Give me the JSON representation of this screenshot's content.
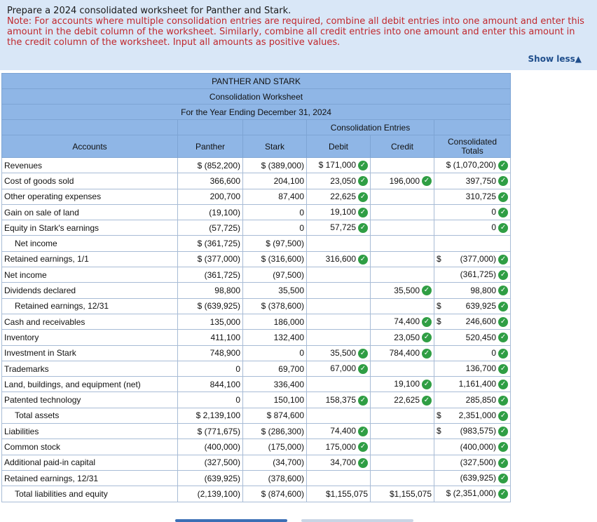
{
  "prompt": {
    "title": "Prepare a 2024 consolidated worksheet for Panther and Stark.",
    "note": "Note: For accounts where multiple consolidation entries are required, combine all debit entries into one amount and enter this amount in the debit column of the worksheet. Similarly, combine all credit entries into one amount and enter this amount in the credit column of the worksheet. Input all amounts as positive values.",
    "show_less": "Show less▲"
  },
  "worksheet": {
    "title1": "PANTHER AND STARK",
    "title2": "Consolidation Worksheet",
    "title3": "For the Year Ending December 31, 2024",
    "entries_header": "Consolidation Entries",
    "col_accounts": "Accounts",
    "col_panther": "Panther",
    "col_stark": "Stark",
    "col_debit": "Debit",
    "col_credit": "Credit",
    "col_totals": "Consolidated Totals",
    "rows": [
      {
        "a": "Revenues",
        "p": "$ (852,200)",
        "s": "$ (389,000)",
        "d": "$  171,000",
        "c": "",
        "t": "$  (1,070,200)"
      },
      {
        "a": "Cost of goods sold",
        "p": "366,600",
        "s": "204,100",
        "d": "23,050",
        "c": "196,000",
        "t": "397,750"
      },
      {
        "a": "Other operating expenses",
        "p": "200,700",
        "s": "87,400",
        "d": "22,625",
        "c": "",
        "t": "310,725"
      },
      {
        "a": "Gain on sale of land",
        "p": "(19,100)",
        "s": "0",
        "d": "19,100",
        "c": "",
        "t": "0"
      },
      {
        "a": "Equity in Stark's earnings",
        "p": "(57,725)",
        "s": "0",
        "d": "57,725",
        "c": "",
        "t": "0"
      },
      {
        "a": "Net income",
        "p": "$ (361,725)",
        "s": "$  (97,500)",
        "d": "",
        "c": "",
        "t": ""
      },
      {
        "a": "Retained earnings, 1/1",
        "p": "$ (377,000)",
        "s": "$ (316,600)",
        "d": "316,600",
        "c": "",
        "t": "(377,000)"
      },
      {
        "a": "Net income",
        "p": "(361,725)",
        "s": "(97,500)",
        "d": "",
        "c": "",
        "t": "(361,725)"
      },
      {
        "a": "Dividends declared",
        "p": "98,800",
        "s": "35,500",
        "d": "",
        "c": "35,500",
        "t": "98,800"
      },
      {
        "a": "Retained earnings, 12/31",
        "p": "$ (639,925)",
        "s": "$ (378,600)",
        "d": "",
        "c": "",
        "t": "639,925"
      },
      {
        "a": "Cash and receivables",
        "p": "135,000",
        "s": "186,000",
        "d": "",
        "c": "74,400",
        "t": "246,600"
      },
      {
        "a": "Inventory",
        "p": "411,100",
        "s": "132,400",
        "d": "",
        "c": "23,050",
        "t": "520,450"
      },
      {
        "a": "Investment in Stark",
        "p": "748,900",
        "s": "0",
        "d": "35,500",
        "c": "784,400",
        "t": "0"
      },
      {
        "a": "Trademarks",
        "p": "0",
        "s": "69,700",
        "d": "67,000",
        "c": "",
        "t": "136,700"
      },
      {
        "a": "Land, buildings, and equipment (net)",
        "p": "844,100",
        "s": "336,400",
        "d": "",
        "c": "19,100",
        "t": "1,161,400"
      },
      {
        "a": "Patented technology",
        "p": "0",
        "s": "150,100",
        "d": "158,375",
        "c": "22,625",
        "t": "285,850"
      },
      {
        "a": "Total assets",
        "p": "$ 2,139,100",
        "s": "$  874,600",
        "d": "",
        "c": "",
        "t": "2,351,000"
      },
      {
        "a": "Liabilities",
        "p": "$ (771,675)",
        "s": "$ (286,300)",
        "d": "74,400",
        "c": "",
        "t": "(983,575)"
      },
      {
        "a": "Common stock",
        "p": "(400,000)",
        "s": "(175,000)",
        "d": "175,000",
        "c": "",
        "t": "(400,000)"
      },
      {
        "a": "Additional paid-in capital",
        "p": "(327,500)",
        "s": "(34,700)",
        "d": "34,700",
        "c": "",
        "t": "(327,500)"
      },
      {
        "a": "Retained earnings, 12/31",
        "p": "(639,925)",
        "s": "(378,600)",
        "d": "",
        "c": "",
        "t": "(639,925)"
      },
      {
        "a": "Total liabilities and equity",
        "p": "(2,139,100)",
        "s": "$ (874,600)",
        "d": "$1,155,075",
        "c": "$1,155,075",
        "t": "$  (2,351,000)"
      }
    ]
  }
}
